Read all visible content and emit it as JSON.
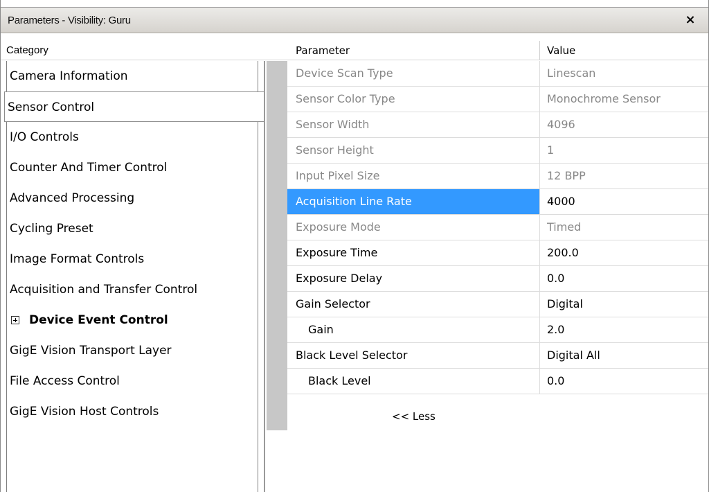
{
  "window": {
    "title": "Parameters - Visibility: Guru",
    "close_glyph": "×"
  },
  "columns": {
    "category": "Category",
    "parameter": "Parameter",
    "value": "Value"
  },
  "categories": [
    {
      "label": "Camera Information"
    },
    {
      "label": "Sensor Control",
      "selected": true
    },
    {
      "label": "I/O Controls"
    },
    {
      "label": "Counter And Timer Control"
    },
    {
      "label": "Advanced Processing"
    },
    {
      "label": "Cycling Preset"
    },
    {
      "label": "Image Format Controls"
    },
    {
      "label": "Acquisition and Transfer Control"
    },
    {
      "label": "Device Event Control",
      "bold": true,
      "expandable": true
    },
    {
      "label": "GigE Vision Transport Layer"
    },
    {
      "label": "File Access Control"
    },
    {
      "label": "GigE Vision Host Controls"
    }
  ],
  "parameters": [
    {
      "name": "Device Scan Type",
      "value": "Linescan",
      "readonly": true
    },
    {
      "name": "Sensor Color Type",
      "value": "Monochrome Sensor",
      "readonly": true
    },
    {
      "name": "Sensor Width",
      "value": "4096",
      "readonly": true
    },
    {
      "name": "Sensor Height",
      "value": "1",
      "readonly": true
    },
    {
      "name": "Input Pixel Size",
      "value": "12 BPP",
      "readonly": true
    },
    {
      "name": "Acquisition Line Rate",
      "value": "4000",
      "selected": true
    },
    {
      "name": "Exposure Mode",
      "value": "Timed",
      "readonly": true
    },
    {
      "name": "Exposure Time",
      "value": "200.0"
    },
    {
      "name": "Exposure Delay",
      "value": "0.0"
    },
    {
      "name": "Gain Selector",
      "value": "Digital"
    },
    {
      "name": "Gain",
      "value": "2.0",
      "indent": true
    },
    {
      "name": "Black Level Selector",
      "value": "Digital All"
    },
    {
      "name": "Black Level",
      "value": "0.0",
      "indent": true
    }
  ],
  "less_link": "<< Less",
  "colors": {
    "selection": "#3399ff",
    "readonly_text": "#888888",
    "gutter": "#c7c7c7"
  }
}
